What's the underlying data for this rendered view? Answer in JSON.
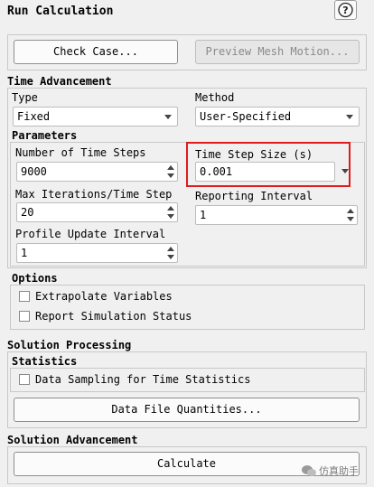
{
  "title": "Run Calculation",
  "help_icon": "question-mark-icon",
  "buttons": {
    "check_case": "Check Case...",
    "preview_mesh": "Preview Mesh Motion..."
  },
  "time_advancement": {
    "header": "Time Advancement",
    "type_label": "Type",
    "type_value": "Fixed",
    "method_label": "Method",
    "method_value": "User-Specified"
  },
  "parameters": {
    "header": "Parameters",
    "num_steps_label": "Number of Time Steps",
    "num_steps_value": "9000",
    "step_size_label": "Time Step Size (s)",
    "step_size_value": "0.001",
    "max_iter_label": "Max Iterations/Time Step",
    "max_iter_value": "20",
    "reporting_label": "Reporting Interval",
    "reporting_value": "1",
    "profile_label": "Profile Update Interval",
    "profile_value": "1"
  },
  "options": {
    "header": "Options",
    "extrapolate": "Extrapolate Variables",
    "report_status": "Report Simulation Status"
  },
  "solution_processing": {
    "header": "Solution Processing",
    "statistics_header": "Statistics",
    "data_sampling": "Data Sampling for Time Statistics",
    "data_file_button": "Data File Quantities..."
  },
  "solution_advancement": {
    "header": "Solution Advancement",
    "calculate_button": "Calculate"
  },
  "watermark": "仿真助手",
  "colors": {
    "highlight": "#e01b1b"
  }
}
